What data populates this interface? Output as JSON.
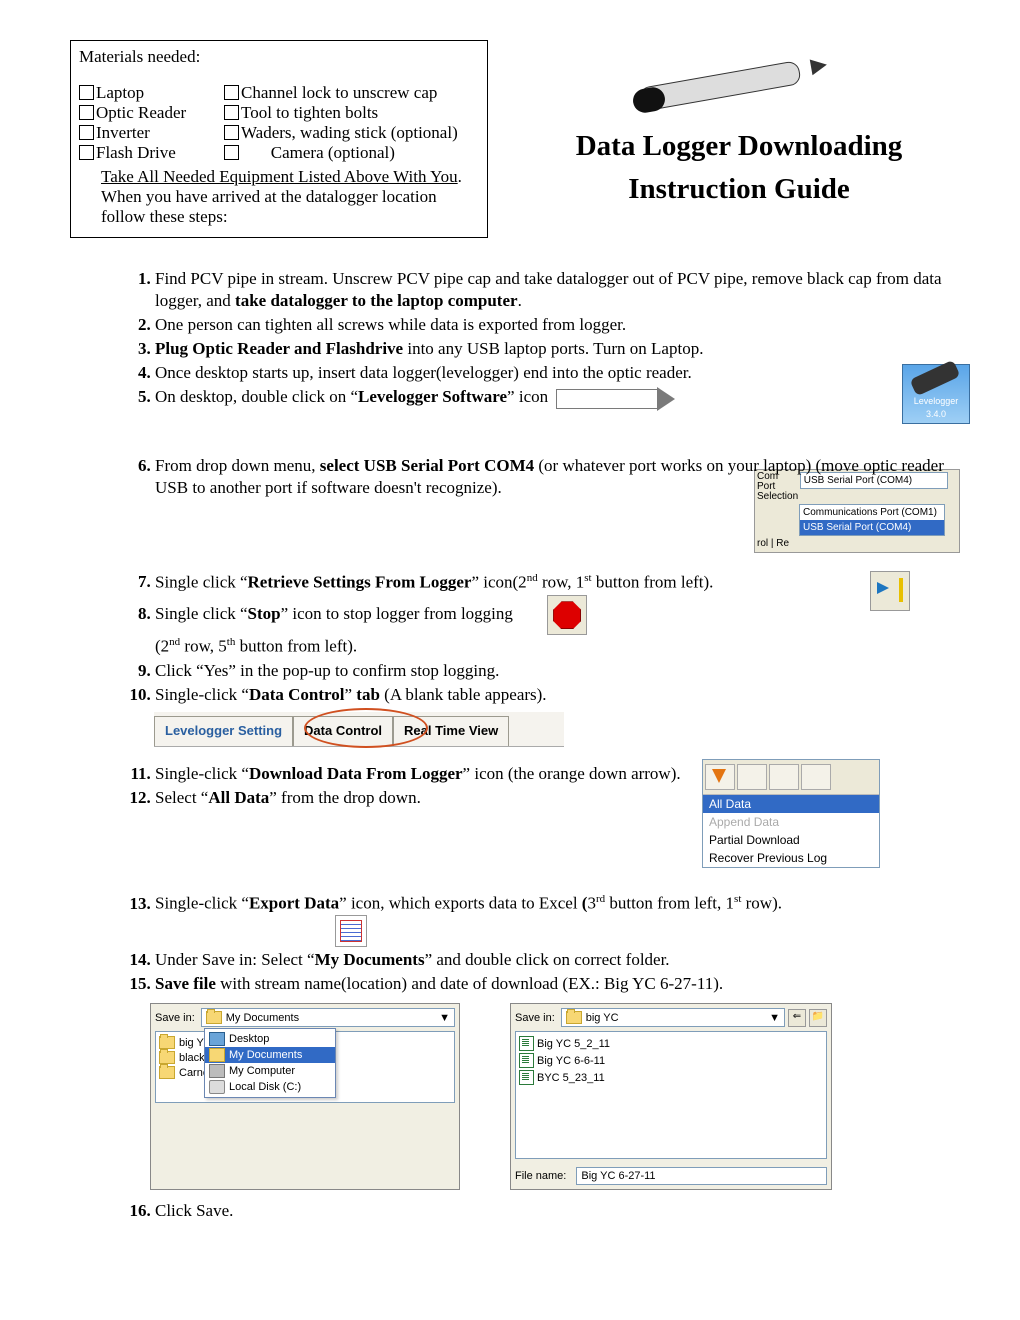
{
  "materials": {
    "title": "Materials needed:",
    "col1": [
      "Laptop",
      "Optic Reader",
      "Inverter",
      "Flash Drive"
    ],
    "col2": [
      "Channel lock to unscrew cap",
      "Tool to tighten bolts",
      "Waders, wading stick (optional)",
      "Camera (optional)"
    ],
    "note1": "Take All Needed Equipment Listed Above With You",
    "note2": ". When you have arrived at the datalogger location follow these steps:"
  },
  "title1": "Data Logger Downloading",
  "title2": "Instruction Guide",
  "lev_icon": {
    "name": "Levelogger",
    "ver": "3.4.0"
  },
  "comport": {
    "label": "Com Port Selection",
    "selected": "USB Serial Port (COM4)",
    "opt1": "Communications Port (COM1)",
    "opt2": "USB Serial Port (COM4)",
    "bottom": "rol | Re"
  },
  "tabs": {
    "t1": "Levelogger Setting",
    "t2": "Data Control",
    "t3": "Real Time View"
  },
  "dropdown": {
    "o1": "All Data",
    "o2": "Append Data",
    "o3": "Partial Download",
    "o4": "Recover Previous Log"
  },
  "dlg1": {
    "savein": "Save in:",
    "combo": "My Documents",
    "files": [
      "big YC",
      "blackli",
      "Carne"
    ],
    "popup": [
      "Desktop",
      "My Documents",
      "My Computer",
      "Local Disk (C:)"
    ]
  },
  "dlg2": {
    "savein": "Save in:",
    "combo": "big YC",
    "files": [
      "Big YC 5_2_11",
      "Big YC 6-6-11",
      "BYC 5_23_11"
    ],
    "fname_label": "File name:",
    "fname": "Big YC 6-27-11"
  },
  "steps": {
    "s1a": "Find PCV pipe in stream. Unscrew PCV pipe cap and take datalogger out of PCV pipe, remove black cap from data logger, and ",
    "s1b": "take datalogger to the laptop computer",
    "s2": "One person can tighten all screws while data is exported from logger.",
    "s3a": "Plug Optic Reader and Flashdrive",
    "s3b": " into any USB laptop ports. Turn on Laptop.",
    "s4": "Once desktop starts up, insert data logger(levelogger) end into the optic reader.",
    "s5a": "On desktop, double click on “",
    "s5b": "Levelogger Software",
    "s5c": "” icon",
    "s6a": "From drop down menu, ",
    "s6b": "select USB Serial Port COM4",
    "s6c": " (or whatever port works on your laptop) (move optic reader USB to another port if software doesn't recognize).",
    "s7a": "Single click “",
    "s7b": "Retrieve Settings From Logger",
    "s7c": "” icon(2",
    "s7d": " row, 1",
    "s7e": " button from left).",
    "s8a": "Single click “",
    "s8b": "Stop",
    "s8c": "” icon to stop logger from logging",
    "s8d": "(2",
    "s8e": " row, 5",
    "s8f": " button from left).",
    "s9": "Click “Yes” in the pop-up to confirm stop logging.",
    "s10a": "Single-click “",
    "s10b": "Data Control",
    "s10c": "” ",
    "s10d": "tab",
    "s10e": " (A blank table appears).",
    "s11a": "Single-click “",
    "s11b": "Download Data From Logger",
    "s11c": "” icon (the orange down arrow).",
    "s12a": "Select “",
    "s12b": "All Data",
    "s12c": "” from the drop down.",
    "s13a": "Single-click “",
    "s13b": "Export Data",
    "s13c": "” icon, which exports data to Excel ",
    "s13d": "(",
    "s13e": "3",
    "s13f": " button from left, 1",
    "s13g": " row).",
    "s14a": "Under Save in: Select “",
    "s14b": "My Documents",
    "s14c": "” and double click on correct folder.",
    "s15a": "Save file",
    "s15b": " with stream name(location) and date of download (EX.: Big YC 6-27-11).",
    "s16": "Click Save."
  }
}
